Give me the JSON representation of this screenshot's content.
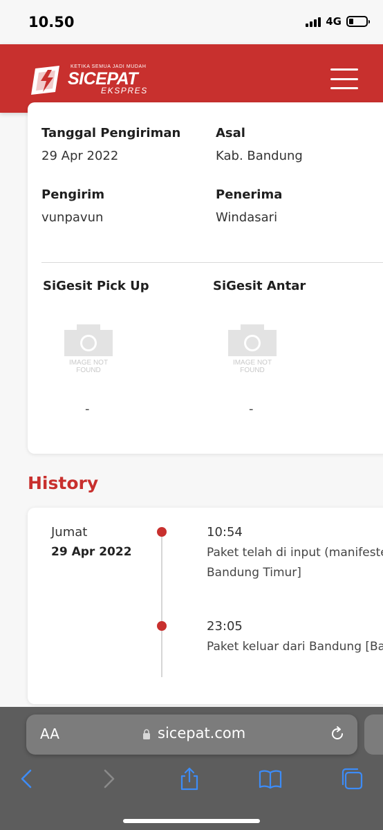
{
  "status_bar": {
    "time": "10.50",
    "network": "4G"
  },
  "header": {
    "logo": {
      "tagline": "KETIKA SEMUA JADI MUDAH",
      "name": "SICEPAT",
      "sub": "EKSPRES"
    },
    "menu_icon": "hamburger-menu-icon",
    "brand_color": "#c8302e"
  },
  "shipment": {
    "shipping_date_label": "Tanggal Pengiriman",
    "shipping_date_value": "29 Apr 2022",
    "origin_label": "Asal",
    "origin_value": "Kab. Bandung",
    "sender_label": "Pengirim",
    "sender_value": "vunpavun",
    "recipient_label": "Penerima",
    "recipient_value": "Windasari",
    "pickup_label": "SiGesit Pick Up",
    "pickup_value": "-",
    "delivery_label": "SiGesit Antar",
    "delivery_value": "-",
    "image_placeholder_text": "IMAGE NOT FOUND"
  },
  "history": {
    "title": "History",
    "day": "Jumat",
    "date": "29 Apr 2022",
    "events": [
      {
        "time": "10:54",
        "desc_line1": "Paket telah di input (manifeste",
        "desc_line2": "Bandung Timur]"
      },
      {
        "time": "23:05",
        "desc_line1": "Paket keluar dari Bandung [Ba"
      }
    ]
  },
  "browser": {
    "text_size_label": "AA",
    "url": "sicepat.com",
    "icons": [
      "lock-icon",
      "reload-icon",
      "back-icon",
      "forward-icon",
      "share-icon",
      "bookmarks-icon",
      "tabs-icon"
    ]
  }
}
